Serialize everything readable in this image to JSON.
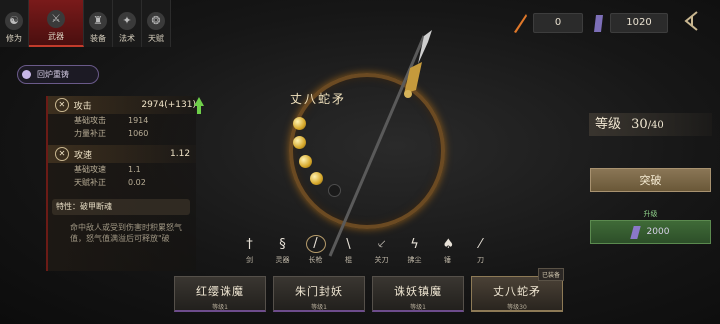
{
  "tabs": [
    {
      "label": "修为",
      "icon": "cultivator-icon"
    },
    {
      "label": "武器",
      "icon": "weapon-icon",
      "active": true
    },
    {
      "label": "装备",
      "icon": "armor-icon"
    },
    {
      "label": "法术",
      "icon": "spell-icon"
    },
    {
      "label": "天赋",
      "icon": "talent-icon"
    }
  ],
  "currency": {
    "fire": "0",
    "gem": "1020"
  },
  "back_label": "回炉重铸",
  "stats": {
    "attack": {
      "label": "攻击",
      "value": "2974(+131)",
      "base_label": "基础攻击",
      "base": "1914",
      "bonus_label": "力量补正",
      "bonus": "1060"
    },
    "speed": {
      "label": "攻速",
      "value": "1.12",
      "base_label": "基础攻速",
      "base": "1.1",
      "bonus_label": "天赋补正",
      "bonus": "0.02"
    }
  },
  "special": "特性：破甲断魂",
  "description": "命中敌人或受到伤害时积累怒气值，怒气值满溢后可释放\"破",
  "weapon_name": "丈八蛇矛",
  "level": {
    "label": "等级",
    "current": "30",
    "max": "/40"
  },
  "breakthrough_label": "突破",
  "upgrade": {
    "label": "升级",
    "cost": "2000"
  },
  "weapon_types": [
    {
      "label": "剑"
    },
    {
      "label": "灵器"
    },
    {
      "label": "长枪",
      "selected": true
    },
    {
      "label": "棍"
    },
    {
      "label": "关刀"
    },
    {
      "label": "拂尘"
    },
    {
      "label": "锤"
    },
    {
      "label": "刀"
    }
  ],
  "skins": [
    {
      "name": "红缨诛魔",
      "level": "等级1"
    },
    {
      "name": "朱门封妖",
      "level": "等级1"
    },
    {
      "name": "诛妖镇魔",
      "level": "等级1"
    },
    {
      "name": "丈八蛇矛",
      "level": "等级30",
      "equipped": true,
      "tag": "已装备"
    }
  ],
  "colors": {
    "accent_red": "#c23b2b",
    "gold": "#d5a72a",
    "upgrade_green": "#3f6a37",
    "purple": "#6d4c8c"
  }
}
